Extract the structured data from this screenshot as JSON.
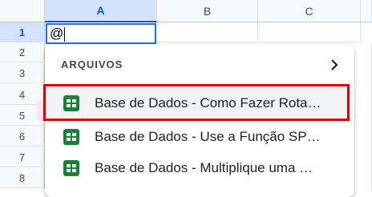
{
  "columns": [
    "A",
    "B",
    "C"
  ],
  "rows": [
    "1",
    "2",
    "3",
    "4",
    "5",
    "6",
    "7",
    "8"
  ],
  "active_cell": {
    "value": "@"
  },
  "dropdown": {
    "section_title": "ARQUIVOS",
    "items": [
      {
        "label": "Base de Dados - Como Fazer Rota…",
        "icon": "google-sheets-icon",
        "highlighted": true
      },
      {
        "label": "Base de Dados - Use a Função SP…",
        "icon": "google-sheets-icon"
      },
      {
        "label": "Base de Dados - Multiplique uma …",
        "icon": "google-sheets-icon"
      }
    ]
  },
  "colors": {
    "sheets_green": "#188038",
    "selection_blue": "#1a73e8",
    "annotation_red": "#d50000"
  }
}
